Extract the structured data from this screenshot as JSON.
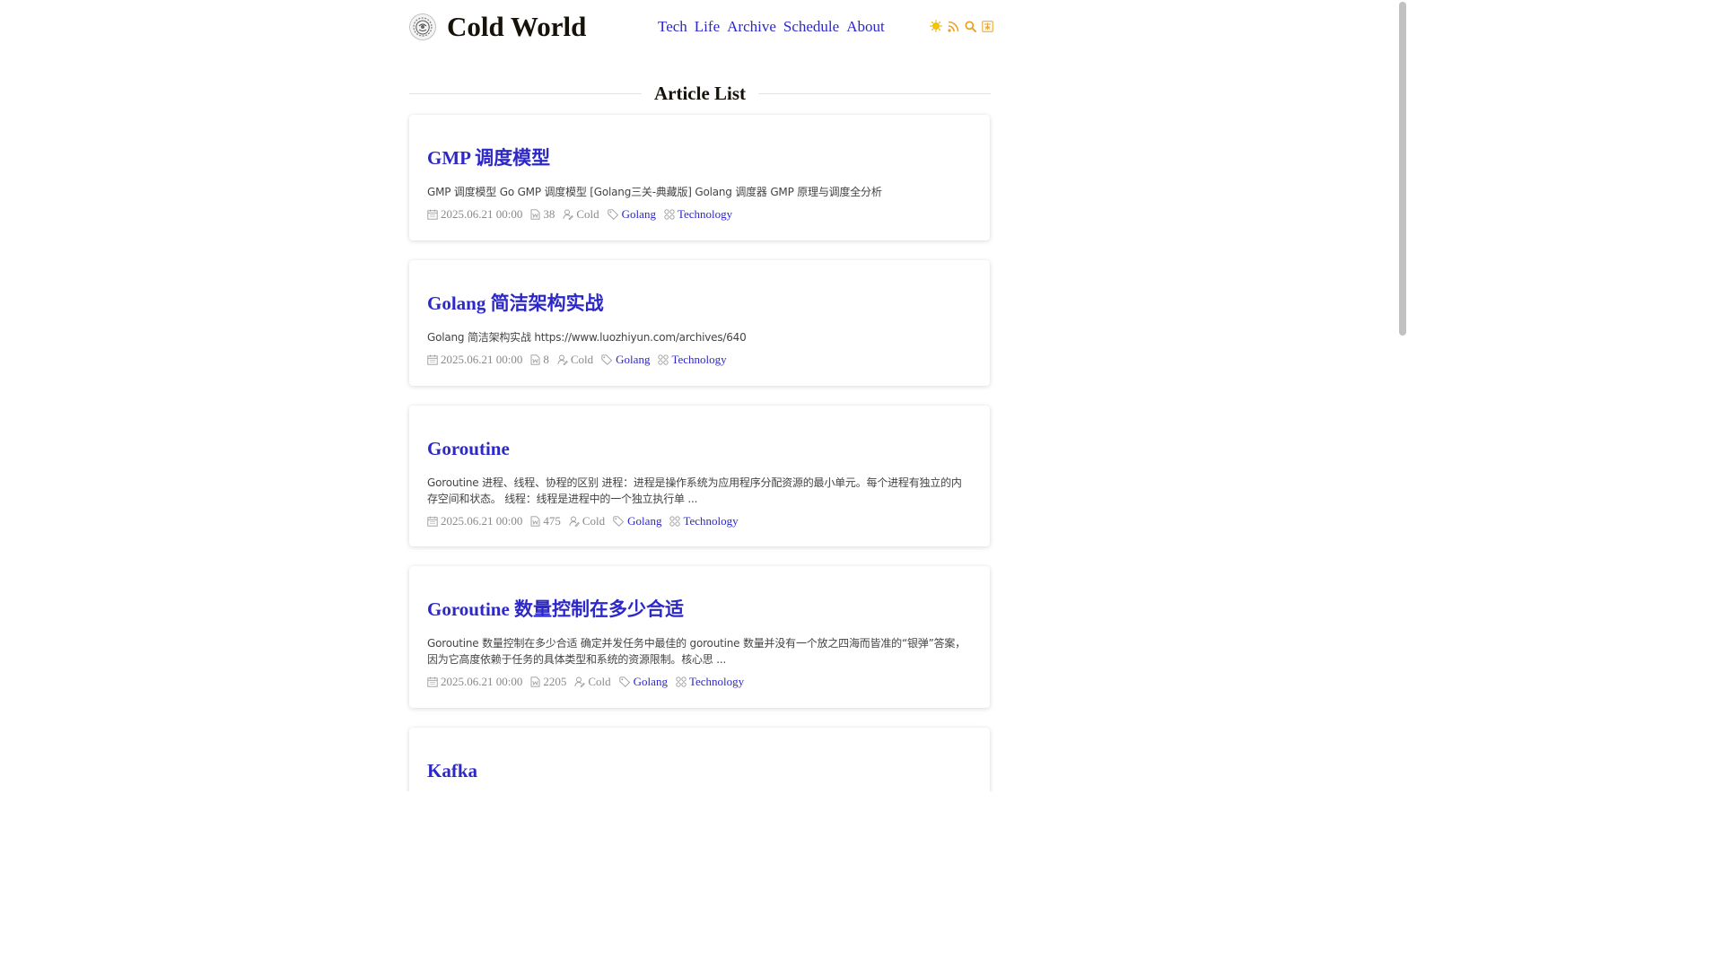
{
  "site": {
    "title": "Cold World"
  },
  "nav": {
    "items": [
      {
        "label": "Tech"
      },
      {
        "label": "Life"
      },
      {
        "label": "Archive"
      },
      {
        "label": "Schedule"
      },
      {
        "label": "About"
      }
    ]
  },
  "header_icons": [
    "sun-icon",
    "rss-icon",
    "search-icon",
    "translate-icon"
  ],
  "section": {
    "heading": "Article List"
  },
  "articles": [
    {
      "title": "GMP 调度模型",
      "summary": "GMP 调度模型 Go GMP 调度模型 [Golang三关-典藏版] Golang 调度器 GMP 原理与调度全分析",
      "date": "2025.06.21 00:00",
      "words": "38",
      "author": "Cold",
      "tag": "Golang",
      "category": "Technology"
    },
    {
      "title": "Golang 简洁架构实战",
      "summary": "Golang 简洁架构实战 https://www.luozhiyun.com/archives/640",
      "date": "2025.06.21 00:00",
      "words": "8",
      "author": "Cold",
      "tag": "Golang",
      "category": "Technology"
    },
    {
      "title": "Goroutine",
      "summary": "Goroutine 进程、线程、协程的区别 进程：进程是操作系统为应用程序分配资源的最小单元。每个进程有独立的内存空间和状态。 线程：线程是进程中的一个独立执行单 ...",
      "date": "2025.06.21 00:00",
      "words": "475",
      "author": "Cold",
      "tag": "Golang",
      "category": "Technology"
    },
    {
      "title": "Goroutine 数量控制在多少合适",
      "summary": "Goroutine 数量控制在多少合适 确定并发任务中最佳的 goroutine 数量并没有一个放之四海而皆准的“银弹”答案，因为它高度依赖于任务的具体类型和系统的资源限制。核心思 ...",
      "date": "2025.06.21 00:00",
      "words": "2205",
      "author": "Cold",
      "tag": "Golang",
      "category": "Technology"
    },
    {
      "title": "Kafka"
    }
  ],
  "colors": {
    "link": "#2d28c8",
    "title": "#161209",
    "meta": "#8a8a8a",
    "sun": "#f0b000",
    "icon_accent": "#e8a020"
  }
}
